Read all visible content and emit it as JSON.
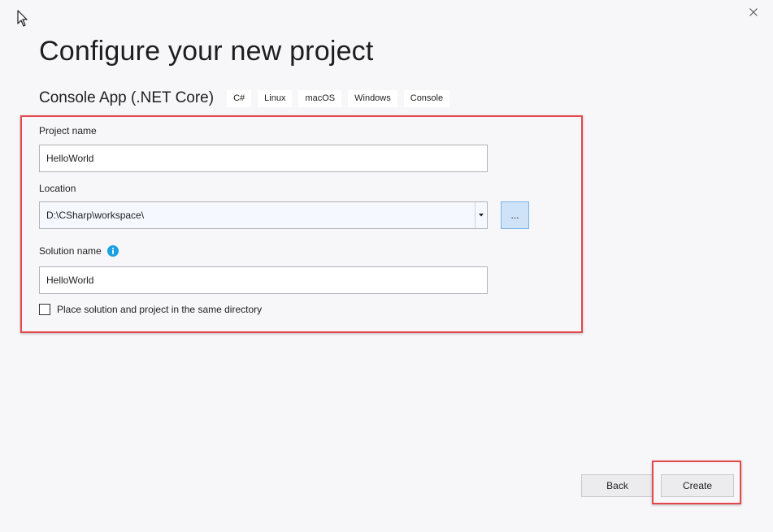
{
  "header": {
    "title": "Configure your new project",
    "template_name": "Console App (.NET Core)",
    "tags": [
      "C#",
      "Linux",
      "macOS",
      "Windows",
      "Console"
    ]
  },
  "form": {
    "project_name_label": "Project name",
    "project_name_value": "HelloWorld",
    "location_label": "Location",
    "location_value": "D:\\CSharp\\workspace\\",
    "browse_label": "...",
    "solution_name_label": "Solution name",
    "solution_name_value": "HelloWorld",
    "same_dir_label": "Place solution and project in the same directory",
    "same_dir_checked": false
  },
  "footer": {
    "back_label": "Back",
    "create_label": "Create"
  },
  "icons": {
    "close": "close-icon",
    "info": "info-icon",
    "dropdown": "chevron-down-icon",
    "cursor": "mouse-pointer-icon"
  },
  "colors": {
    "highlight": "#e3474a",
    "info_blue": "#1ba1e2",
    "browse_bg": "#cfe3f8",
    "background": "#f7f7f9"
  }
}
